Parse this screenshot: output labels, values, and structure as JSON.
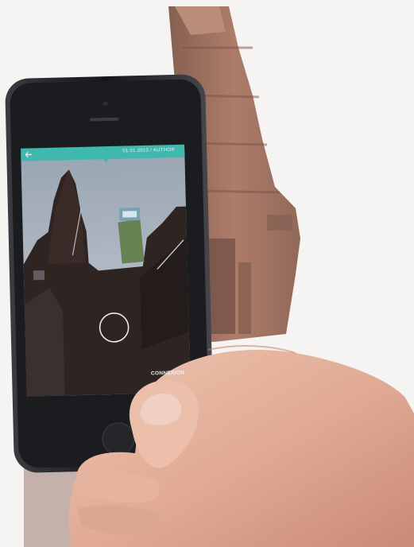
{
  "photo": {
    "subject": "hand-holding-smartphone-in-front-of-cathedral",
    "colors": {
      "sky": "#f4f3f2",
      "tower": "#9c6b57",
      "phone_body": "#1c1d20",
      "app_bar": "#3fb8ae",
      "screen_sky": "#aab3bf",
      "skin": "#e0ae98"
    }
  },
  "app_screen": {
    "top_bar_text": "01.01.2010 / AUTHOR",
    "bottom_action_text": "CONNEXION",
    "back_icon": "back-arrow-icon",
    "capture_icon": "shutter-circle-icon"
  }
}
